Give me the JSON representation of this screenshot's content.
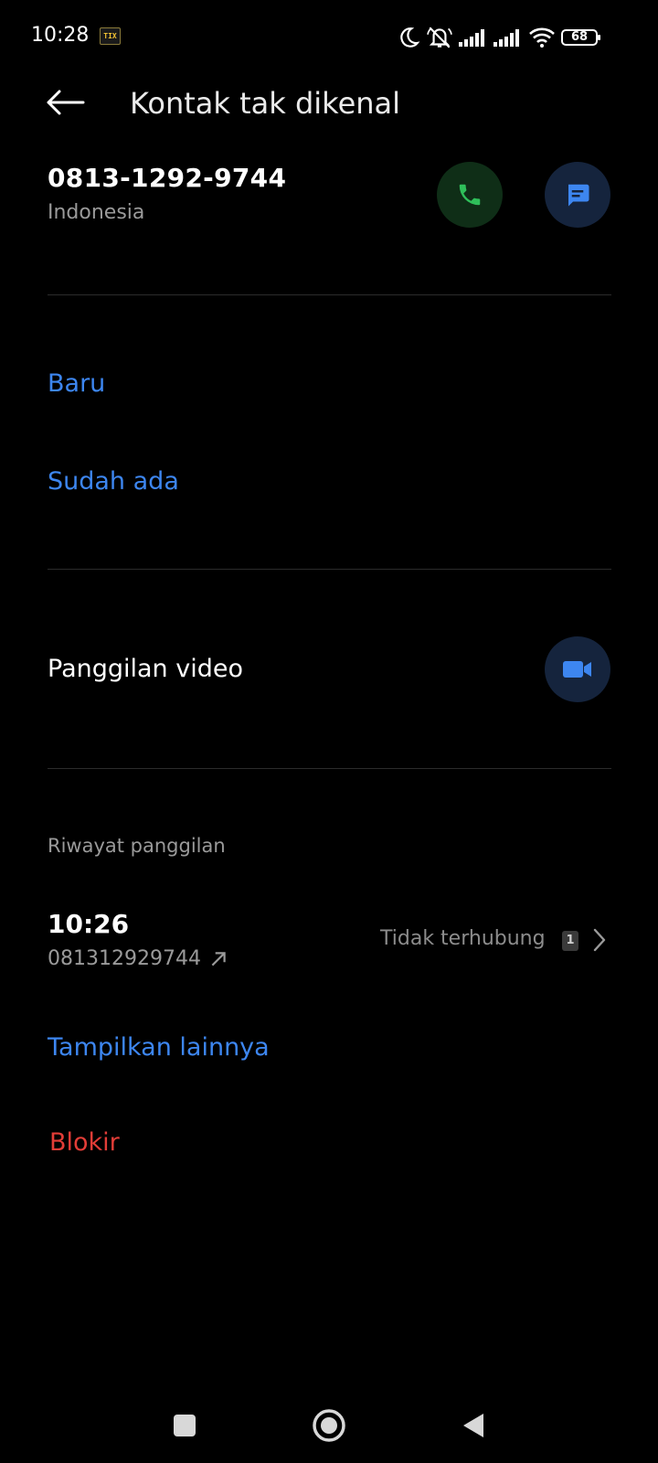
{
  "status_bar": {
    "time": "10:28",
    "notification_badge": "TIX",
    "battery": "68"
  },
  "app_bar": {
    "title": "Kontak tak dikenal"
  },
  "contact": {
    "number": "0813-1292-9744",
    "country": "Indonesia"
  },
  "add_contact": {
    "new_label": "Baru",
    "existing_label": "Sudah ada"
  },
  "video_call": {
    "label": "Panggilan video"
  },
  "call_history": {
    "section_label": "Riwayat panggilan",
    "entries": [
      {
        "time": "10:26",
        "number": "081312929744",
        "status": "Tidak terhubung",
        "sim": "1"
      }
    ],
    "show_more_label": "Tampilkan lainnya"
  },
  "block": {
    "label": "Blokir"
  },
  "colors": {
    "background": "#000000",
    "accent_blue": "#3d86f0",
    "danger_red": "#e23d37",
    "call_green": "#2fbf5a"
  },
  "icons": [
    "back-arrow-icon",
    "phone-icon",
    "message-icon",
    "video-camera-icon",
    "outgoing-call-arrow-icon",
    "sim-card-icon",
    "chevron-right-icon",
    "moon-icon",
    "bell-off-icon",
    "signal-icon",
    "wifi-icon",
    "battery-icon"
  ]
}
